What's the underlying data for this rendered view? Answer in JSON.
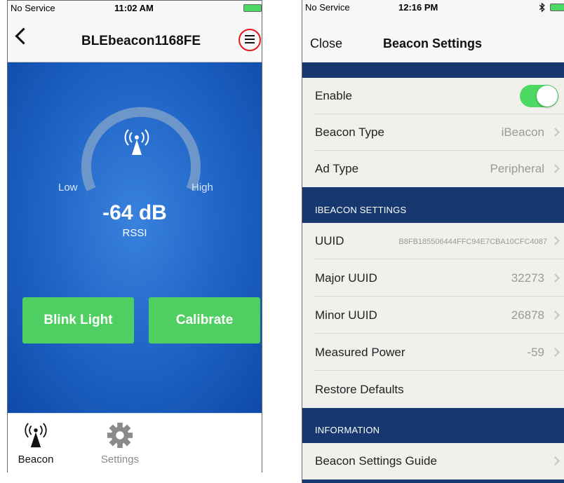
{
  "left": {
    "status": {
      "carrier": "No Service",
      "time": "11:02 AM"
    },
    "title": "BLEbeacon1168FE",
    "gauge": {
      "low_label": "Low",
      "high_label": "High",
      "value": "-64 dB",
      "unit_label": "RSSI"
    },
    "buttons": {
      "blink": "Blink Light",
      "calibrate": "Calibrate"
    },
    "tabs": [
      {
        "label": "Beacon",
        "icon": "beacon-icon"
      },
      {
        "label": "Settings",
        "icon": "gear-icon"
      }
    ],
    "colors": {
      "accent_green": "#4fcf62",
      "background_blue": "#1d62c4",
      "highlight_red": "#e2181d"
    }
  },
  "right": {
    "status": {
      "carrier": "No Service",
      "time": "12:16 PM"
    },
    "nav": {
      "close": "Close",
      "title": "Beacon Settings"
    },
    "general": [
      {
        "label": "Enable",
        "toggle": true
      },
      {
        "label": "Beacon Type",
        "value": "iBeacon"
      },
      {
        "label": "Ad Type",
        "value": "Peripheral"
      }
    ],
    "ibeacon_header": "IBEACON SETTINGS",
    "ibeacon": [
      {
        "label": "UUID",
        "value": "B8FB185506444FFC94E7CBA10CFC4087"
      },
      {
        "label": "Major UUID",
        "value": "32273"
      },
      {
        "label": "Minor UUID",
        "value": "26878"
      },
      {
        "label": "Measured Power",
        "value": "-59"
      },
      {
        "label": "Restore Defaults"
      }
    ],
    "info_header": "INFORMATION",
    "information": [
      {
        "label": "Beacon Settings Guide"
      }
    ],
    "colors": {
      "toggle_green": "#4cd964",
      "section_blue": "#17386f"
    }
  }
}
